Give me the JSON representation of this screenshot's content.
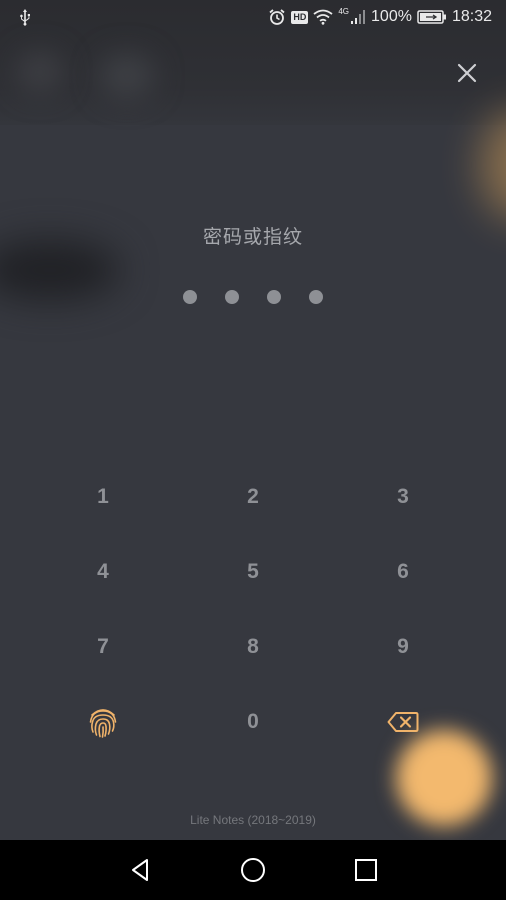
{
  "status_bar": {
    "network_type": "4G",
    "hd_badge": "HD",
    "battery_percent": "100%",
    "time": "18:32"
  },
  "lock": {
    "prompt": "密码或指纹",
    "pin_length": 4
  },
  "keypad": {
    "keys": [
      "1",
      "2",
      "3",
      "4",
      "5",
      "6",
      "7",
      "8",
      "9",
      "0"
    ]
  },
  "footer": {
    "text": "Lite Notes (2018~2019)"
  },
  "colors": {
    "accent": "#f0b36a",
    "background": "#36383f",
    "key_text": "#8f9196"
  },
  "icons": {
    "usb": "usb-icon",
    "alarm": "alarm-icon",
    "wifi": "wifi-icon",
    "signal": "signal-icon",
    "battery": "battery-charging-icon",
    "close": "close-icon",
    "fingerprint": "fingerprint-icon",
    "backspace": "backspace-icon"
  }
}
